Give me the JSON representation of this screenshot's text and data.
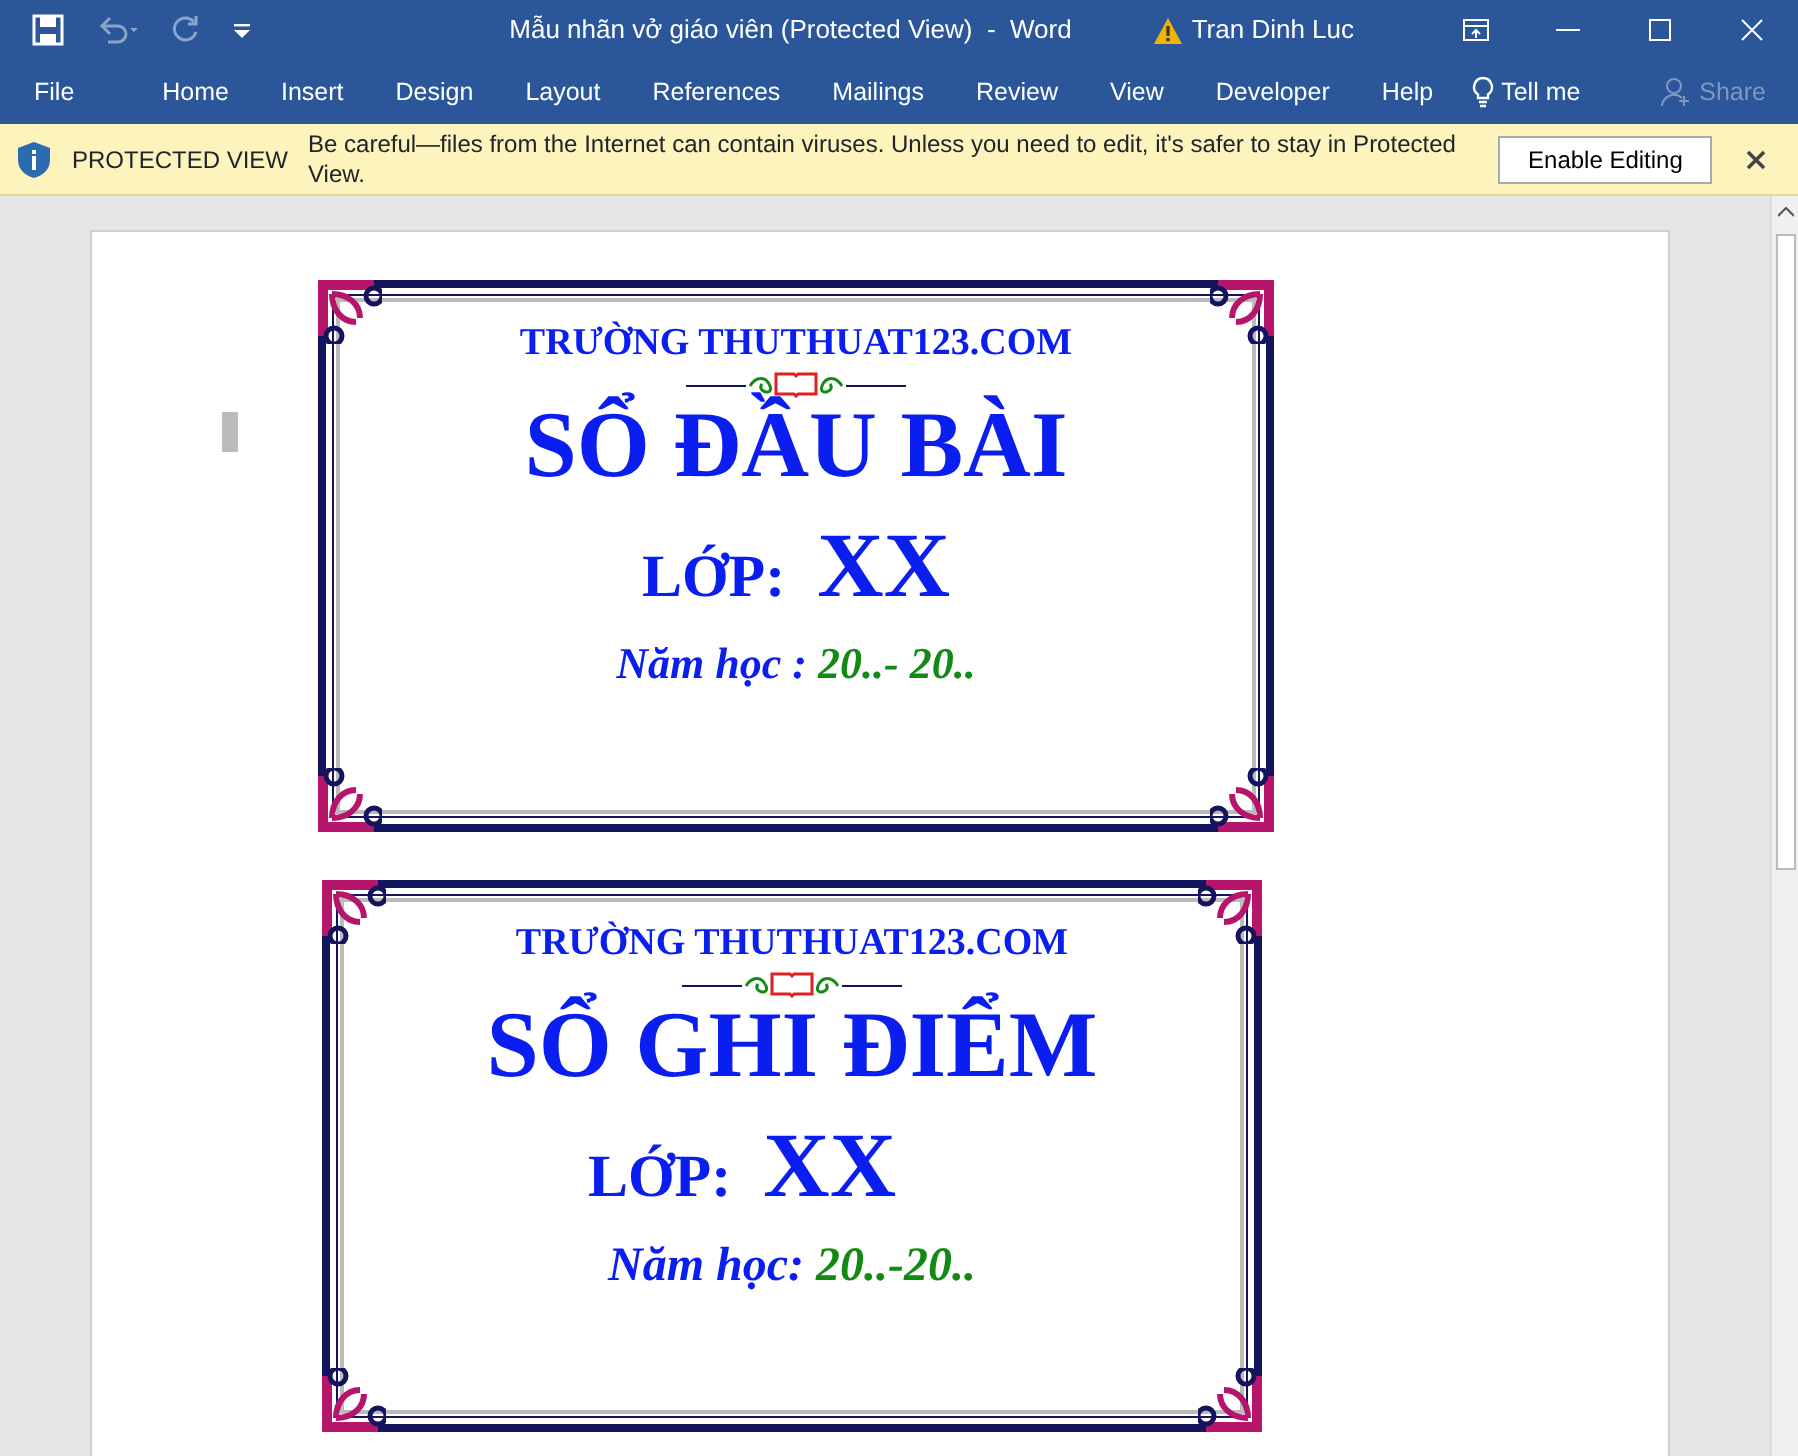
{
  "window": {
    "title": "Mẫu nhãn vở giáo viên (Protected View)  -  Word",
    "user": "Tran Dinh Luc"
  },
  "menu": [
    "File",
    "Home",
    "Insert",
    "Design",
    "Layout",
    "References",
    "Mailings",
    "Review",
    "View",
    "Developer",
    "Help"
  ],
  "tell_me": "Tell me",
  "share": {
    "label": "Share",
    "disabled": true
  },
  "protected_view": {
    "title": "PROTECTED VIEW",
    "message": "Be careful—files from the Internet can contain viruses. Unless you need to edit, it's safer to stay in Protected View.",
    "button": "Enable Editing"
  },
  "labels": [
    {
      "school": "TRƯỜNG THUTHUAT123.COM",
      "title": "SỔ ĐẦU BÀI",
      "class_label": "LỚP:",
      "class_value": "XX",
      "year_label": "Năm học : ",
      "year_value": "20..- 20.."
    },
    {
      "school": "TRƯỜNG THUTHUAT123.COM",
      "title": "SỔ GHI ĐIỂM",
      "class_label": "LỚP:",
      "class_value": "XX",
      "year_label": "Năm học: ",
      "year_value": "20..-20.."
    }
  ]
}
